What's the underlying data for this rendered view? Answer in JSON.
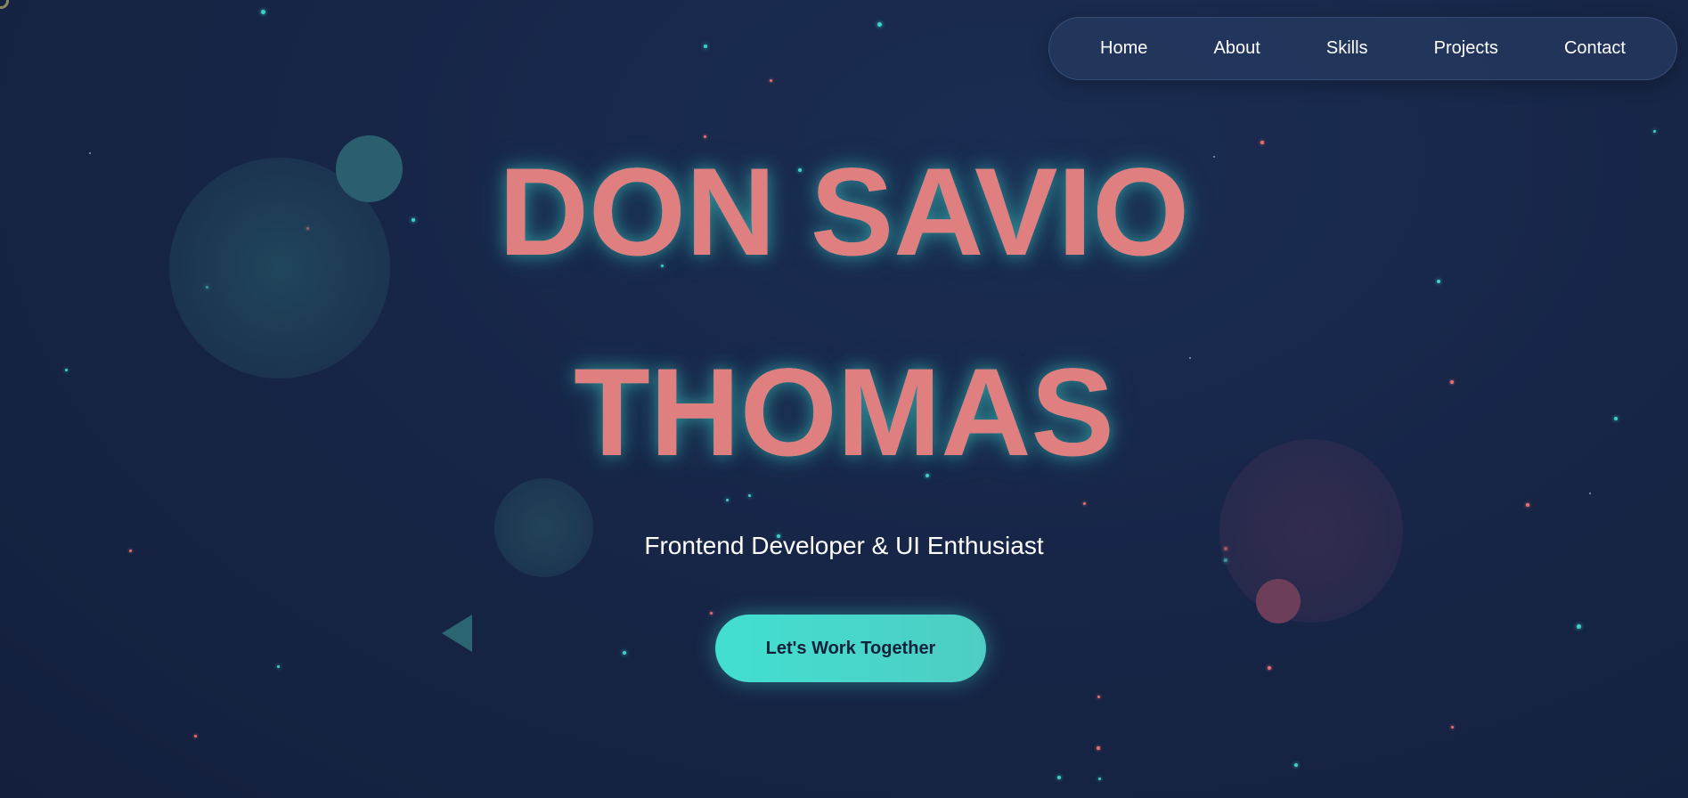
{
  "nav": {
    "items": [
      "Home",
      "About",
      "Skills",
      "Projects",
      "Contact"
    ]
  },
  "hero": {
    "name_line_1": "DON SAVIO",
    "name_line_2": "THOMAS",
    "subtitle": "Frontend Developer & UI Enthusiast",
    "cta_label": "Let's Work Together"
  },
  "colors": {
    "background": "#172647",
    "accent_teal": "#3fd1c8",
    "accent_coral": "#e87b7b",
    "nav_background": "#28406a"
  }
}
